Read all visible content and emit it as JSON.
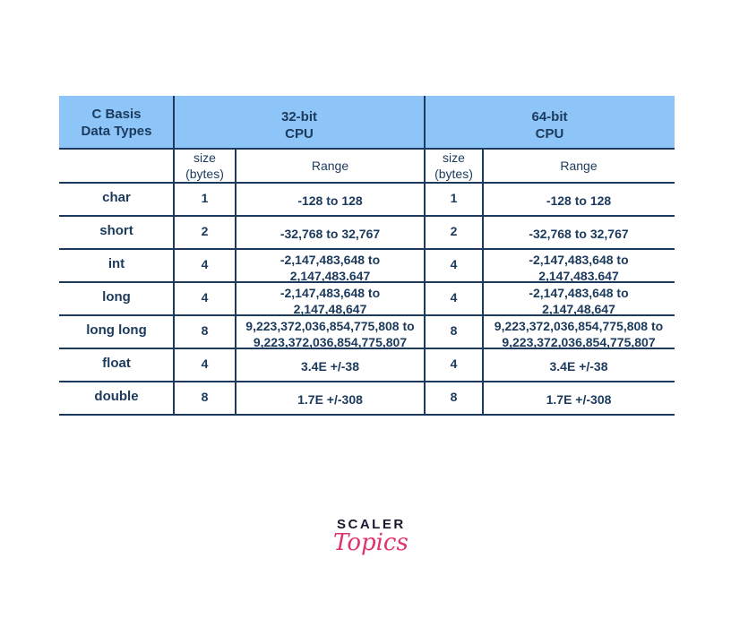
{
  "table": {
    "header": {
      "types_label": "C Basis\nData Types",
      "cpu32": "32-bit\nCPU",
      "cpu64": "64-bit\nCPU"
    },
    "subheader": {
      "size32": "size\n(bytes)",
      "range32": "Range",
      "size64": "size\n(bytes)",
      "range64": "Range"
    },
    "rows": [
      {
        "type": "char",
        "size32": "1",
        "range32": "-128 to 128",
        "size64": "1",
        "range64": "-128 to 128"
      },
      {
        "type": "short",
        "size32": "2",
        "range32": "-32,768 to 32,767",
        "size64": "2",
        "range64": "-32,768 to 32,767"
      },
      {
        "type": "int",
        "size32": "4",
        "range32": "-2,147,483,648 to\n2,147,483.647",
        "size64": "4",
        "range64": "-2,147,483,648 to\n2,147,483.647"
      },
      {
        "type": "long",
        "size32": "4",
        "range32": "-2,147,483,648 to\n2,147,48,647",
        "size64": "4",
        "range64": "-2,147,483,648 to\n2,147,48,647"
      },
      {
        "type": "long long",
        "size32": "8",
        "range32": "9,223,372,036,854,775,808 to\n9,223,372,036,854,775,807",
        "size64": "8",
        "range64": "9,223,372,036,854,775,808 to\n9,223,372,036,854,775,807"
      },
      {
        "type": "float",
        "size32": "4",
        "range32": "3.4E +/-38",
        "size64": "4",
        "range64": "3.4E +/-38"
      },
      {
        "type": "double",
        "size32": "8",
        "range32": "1.7E +/-308",
        "size64": "8",
        "range64": "1.7E +/-308"
      }
    ]
  },
  "logo": {
    "brand": "SCALER",
    "sub": "Topics"
  },
  "colors": {
    "header_bg": "#8ec5f9",
    "text": "#1b3a5c",
    "logo_pink": "#e0336e"
  }
}
